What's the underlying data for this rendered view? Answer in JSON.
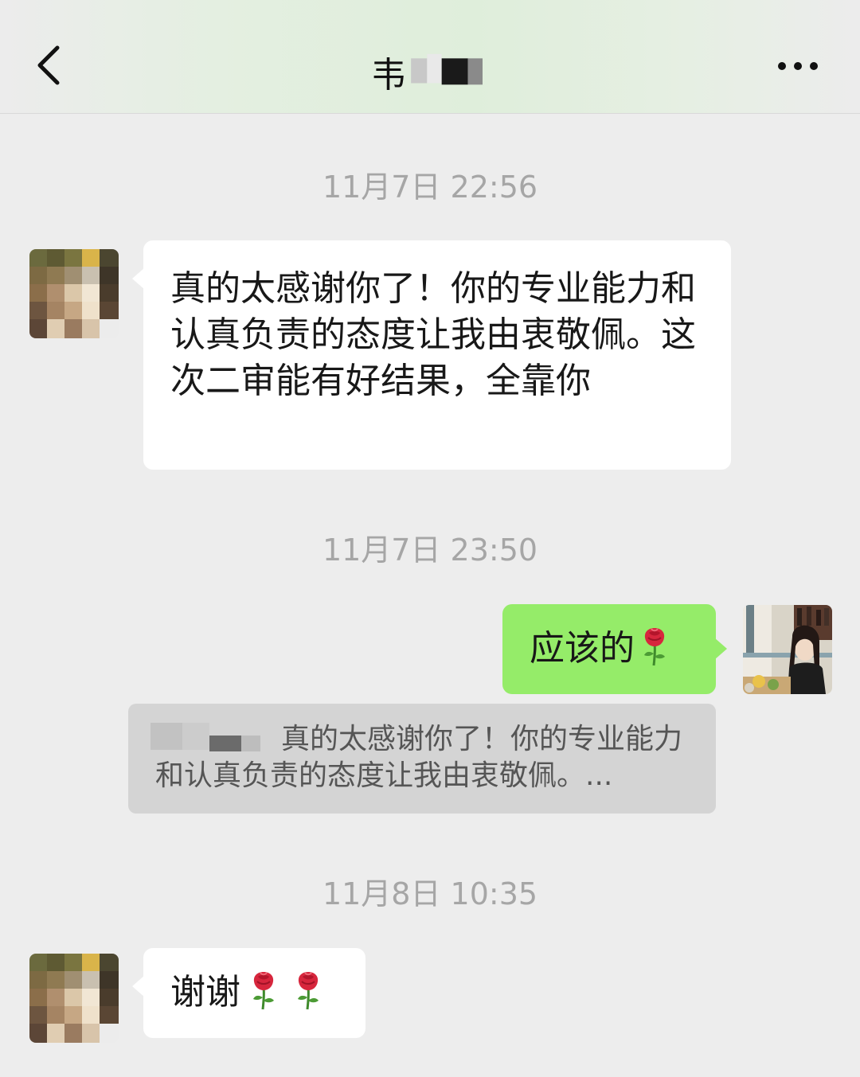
{
  "header": {
    "title": "韦",
    "back_icon": "chevron-left-icon",
    "more_icon": "more-dots-icon"
  },
  "messages": [
    {
      "timestamp": "11月7日 22:56",
      "sender": "contact",
      "text": "真的太感谢你了！你的专业能力和认真负责的态度让我由衷敬佩。这次二审能有好结果，全靠你"
    },
    {
      "timestamp": "11月7日 23:50",
      "sender": "me",
      "text": "应该的",
      "emoji": "rose-icon",
      "quote": {
        "text": "真的太感谢你了！你的专业能力和认真负责的态度让我由衷敬佩。..."
      }
    },
    {
      "timestamp": "11月8日 10:35",
      "sender": "contact",
      "text": "谢谢",
      "emoji_count": 2,
      "emoji": "rose-icon"
    }
  ],
  "colors": {
    "background": "#ededed",
    "incoming_bubble": "#ffffff",
    "outgoing_bubble": "#95ec69",
    "quote_bg": "#d4d4d4",
    "timestamp_text": "#a6a6a6"
  }
}
